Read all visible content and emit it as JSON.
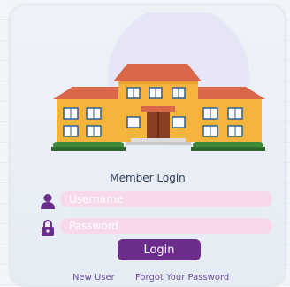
{
  "colors": {
    "accent": "#6a2d8c",
    "field_bg": "#f8d9ec",
    "card_bg": "#eef2f8",
    "roof": "#d9674a",
    "wall": "#f5b43b",
    "window": "#2f5f8f",
    "bush": "#3f8b3a"
  },
  "illustration": {
    "icon": "school-building-icon"
  },
  "login": {
    "title": "Member Login",
    "username": {
      "icon": "user-icon",
      "placeholder": "Username",
      "value": ""
    },
    "password": {
      "icon": "lock-icon",
      "placeholder": "Password",
      "value": ""
    },
    "button_label": "Login"
  },
  "links": {
    "new_user": "New User",
    "forgot": "Forgot Your Password"
  }
}
